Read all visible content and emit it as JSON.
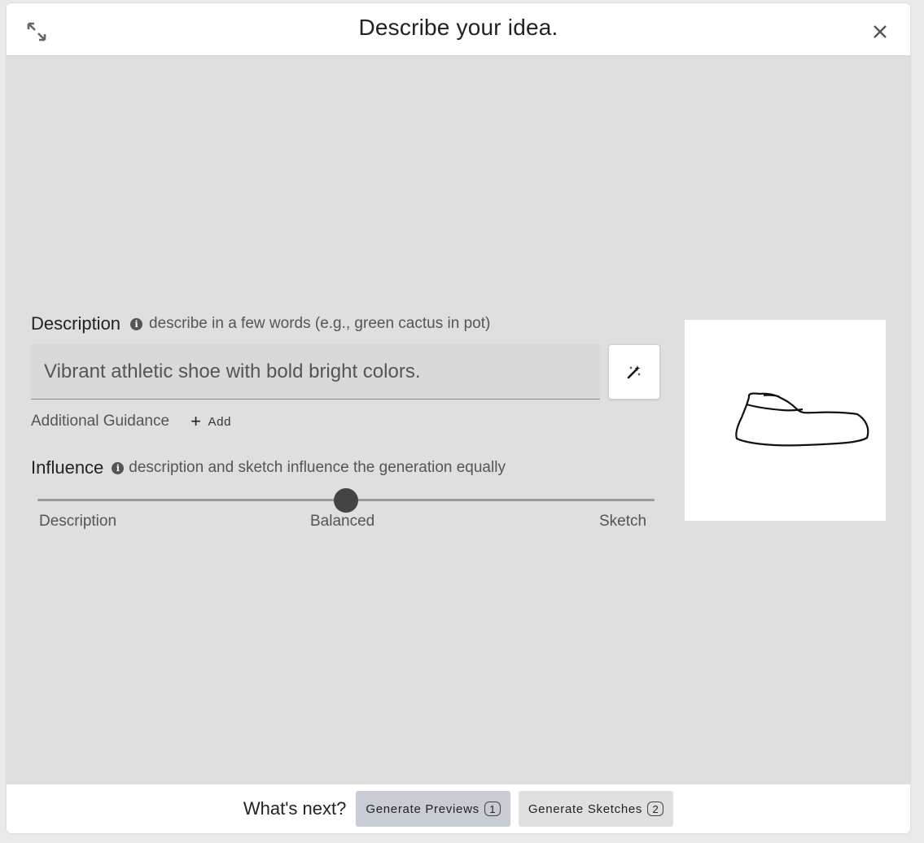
{
  "header": {
    "title": "Describe your idea.",
    "expand_icon": "expand-arrows-icon",
    "close_icon": "close-icon"
  },
  "description": {
    "label": "Description",
    "hint": "describe in a few words (e.g., green cactus in pot)",
    "value": "",
    "placeholder": "Vibrant athletic shoe with bold bright colors.",
    "magic_button_icon": "magic-wand-icon"
  },
  "guidance": {
    "label": "Additional Guidance",
    "add_label": "Add"
  },
  "influence": {
    "label": "Influence",
    "hint": "description and sketch influence the generation equally",
    "left_label": "Description",
    "center_label": "Balanced",
    "right_label": "Sketch",
    "value": 0.5
  },
  "sketch": {
    "description": "hand-drawn shoe outline"
  },
  "footer": {
    "prompt": "What's next?",
    "primary_label": "Generate Previews",
    "primary_badge": "1",
    "secondary_label": "Generate Sketches",
    "secondary_badge": "2"
  },
  "colors": {
    "panel_background": "#dfdfdf",
    "primary_button": "#c8ccd5",
    "slider_thumb": "#444444"
  }
}
